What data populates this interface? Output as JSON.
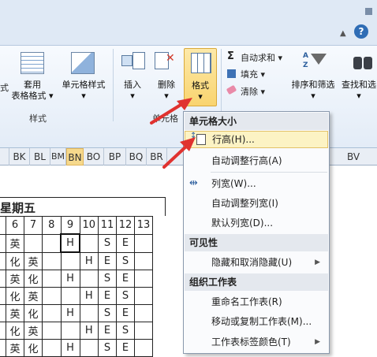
{
  "window": {
    "help_glyph": "?",
    "min_glyph": "▲"
  },
  "ribbon": {
    "table_format": {
      "line1": "套用",
      "line2": "表格格式 ▾"
    },
    "cell_style": {
      "line1": "单元格样式",
      "line2": "▾"
    },
    "insert": {
      "label": "插入",
      "arrow": "▾"
    },
    "delete": {
      "label": "删除",
      "arrow": "▾"
    },
    "format": {
      "label": "格式",
      "arrow": "▾"
    },
    "autosum": "自动求和 ▾",
    "fill": "填充 ▾",
    "clear": "清除 ▾",
    "sigma": "Σ",
    "sort_filter": {
      "line1": "排序和筛选",
      "line2": "▾"
    },
    "find_select": {
      "line1": "查找和选",
      "line2": "▾"
    },
    "group_styles": "样式",
    "group_cells": "单元格",
    "left_edge_char": "式"
  },
  "columns": [
    "BK",
    "BL",
    "BM",
    "BN",
    "BO",
    "BP",
    "BQ",
    "BR",
    "BV"
  ],
  "sheet": {
    "weekday": "星期五",
    "header_nums": [
      "6",
      "7",
      "8",
      "9",
      "10",
      "11",
      "12",
      "13"
    ],
    "rows": [
      [
        "英",
        "",
        "",
        "H",
        "",
        "S",
        "E",
        ""
      ],
      [
        "化",
        "英",
        "",
        "",
        "H",
        "E",
        "S",
        ""
      ],
      [
        "英",
        "化",
        "",
        "H",
        "",
        "S",
        "E",
        ""
      ],
      [
        "化",
        "英",
        "",
        "",
        "H",
        "E",
        "S",
        ""
      ],
      [
        "英",
        "化",
        "",
        "H",
        "",
        "S",
        "E",
        ""
      ],
      [
        "化",
        "英",
        "",
        "",
        "H",
        "E",
        "S",
        ""
      ],
      [
        "英",
        "化",
        "",
        "H",
        "",
        "S",
        "E",
        ""
      ]
    ]
  },
  "menu": {
    "section_size": "单元格大小",
    "row_height": "行高(H)...",
    "autofit_row": "自动调整行高(A)",
    "col_width": "列宽(W)...",
    "autofit_col": "自动调整列宽(I)",
    "default_width": "默认列宽(D)...",
    "section_visibility": "可见性",
    "hide_unhide": "隐藏和取消隐藏(U)",
    "section_organize": "组织工作表",
    "rename_sheet": "重命名工作表(R)",
    "move_copy": "移动或复制工作表(M)...",
    "tab_color": "工作表标签颜色(T)",
    "submenu_arrow": "▶"
  },
  "colors": {
    "accent_red": "#e0322f",
    "highlight": "#fcf3c4"
  }
}
